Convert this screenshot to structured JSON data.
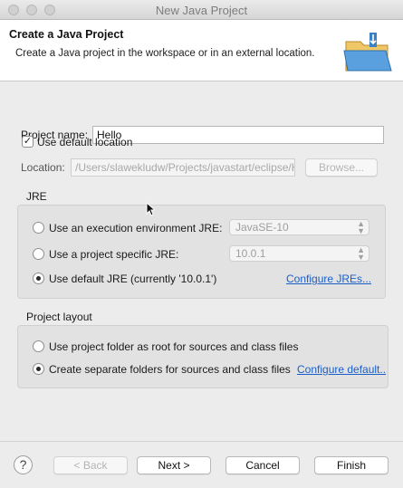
{
  "window": {
    "title": "New Java Project"
  },
  "banner": {
    "title": "Create a Java Project",
    "description": "Create a Java project in the workspace or in an external location."
  },
  "project_name": {
    "label": "Project name:",
    "value": "Hello"
  },
  "use_default_location": {
    "label": "Use default location",
    "checked": true
  },
  "location": {
    "label": "Location:",
    "value": "/Users/slawekludw/Projects/javastart/eclipse/H",
    "browse_label": "Browse..."
  },
  "jre": {
    "group_title": "JRE",
    "options": [
      {
        "label": "Use an execution environment JRE:",
        "selected": false,
        "select_value": "JavaSE-10"
      },
      {
        "label": "Use a project specific JRE:",
        "selected": false,
        "select_value": "10.0.1"
      },
      {
        "label": "Use default JRE (currently '10.0.1')",
        "selected": true
      }
    ],
    "configure_link": "Configure JREs..."
  },
  "project_layout": {
    "group_title": "Project layout",
    "options": [
      {
        "label": "Use project folder as root for sources and class files",
        "selected": false
      },
      {
        "label": "Create separate folders for sources and class files",
        "selected": true
      }
    ],
    "configure_link": "Configure default.."
  },
  "footer": {
    "help_symbol": "?",
    "back_label": "< Back",
    "next_label": "Next >",
    "cancel_label": "Cancel",
    "finish_label": "Finish"
  }
}
